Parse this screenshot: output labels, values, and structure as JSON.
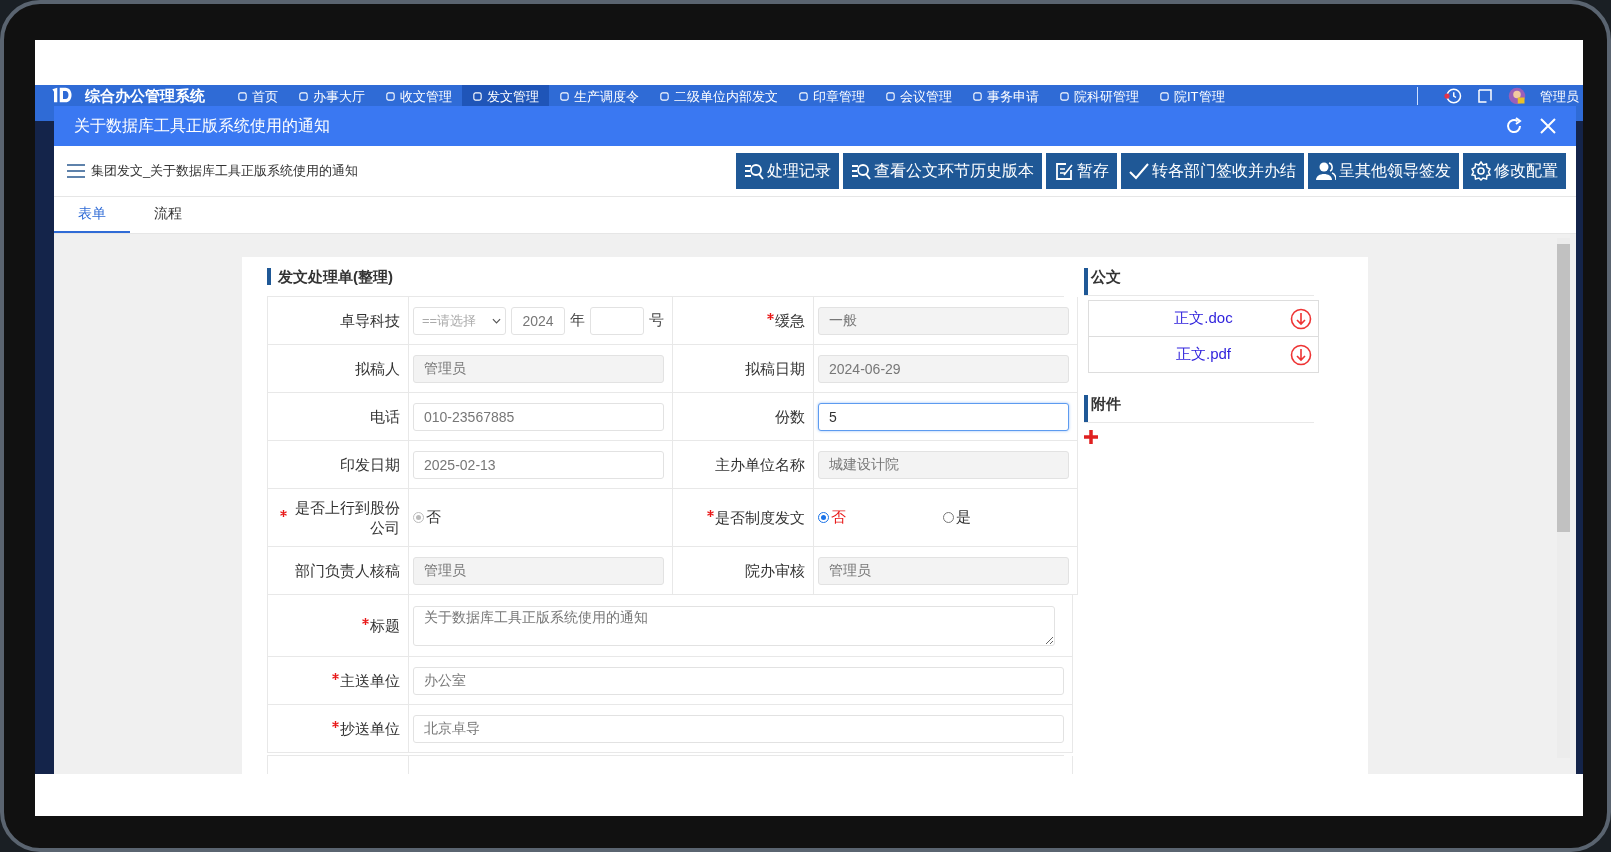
{
  "navbar": {
    "title": "综合办公管理系统",
    "items": [
      {
        "label": "首页",
        "selected": false
      },
      {
        "label": "办事大厅",
        "selected": false
      },
      {
        "label": "收文管理",
        "selected": false
      },
      {
        "label": "发文管理",
        "selected": true
      },
      {
        "label": "生产调度令",
        "selected": false
      },
      {
        "label": "二级单位内部发文",
        "selected": false
      },
      {
        "label": "印章管理",
        "selected": false
      },
      {
        "label": "会议管理",
        "selected": false
      },
      {
        "label": "事务申请",
        "selected": false
      },
      {
        "label": "院科研管理",
        "selected": false
      },
      {
        "label": "院IT管理",
        "selected": false
      }
    ],
    "user": "管理员"
  },
  "dialog": {
    "title": "关于数据库工具正版系统使用的通知",
    "breadcrumb": "集团发文_关于数据库工具正版系统使用的通知",
    "buttons": [
      {
        "label": "处理记录",
        "kind": "history"
      },
      {
        "label": "查看公文环节历史版本",
        "kind": "history"
      },
      {
        "label": "暂存",
        "kind": "save"
      },
      {
        "label": "转各部门签收并办结",
        "kind": "finish"
      },
      {
        "label": "呈其他领导签发",
        "kind": "forward"
      },
      {
        "label": "修改配置",
        "kind": "settings"
      }
    ],
    "tabs": [
      {
        "label": "表单",
        "selected": true
      },
      {
        "label": "流程",
        "selected": false
      }
    ],
    "form": {
      "title": "发文处理单(整理)",
      "rows": [
        [
          {
            "label": "卓导科技",
            "required": false,
            "kind": "doc-number",
            "select": "==请选择",
            "year": "2024",
            "year_unit": "年",
            "number_unit": "号"
          },
          {
            "label": "缓急",
            "required": true,
            "kind": "input",
            "value": "一般",
            "readonly": true
          }
        ],
        [
          {
            "label": "拟稿人",
            "required": false,
            "kind": "input",
            "value": "管理员",
            "readonly": true
          },
          {
            "label": "拟稿日期",
            "required": false,
            "kind": "input",
            "value": "2024-06-29",
            "readonly": true
          }
        ],
        [
          {
            "label": "电话",
            "required": false,
            "kind": "input",
            "value": "010-23567885",
            "readonly": false
          },
          {
            "label": "份数",
            "required": false,
            "kind": "input",
            "value": "5",
            "readonly": false,
            "focused": true
          }
        ],
        [
          {
            "label": "印发日期",
            "required": false,
            "kind": "input",
            "value": "2025-02-13",
            "readonly": false
          },
          {
            "label": "主办单位名称",
            "required": false,
            "kind": "input",
            "value": "城建设计院",
            "readonly": true
          }
        ],
        [
          {
            "label": "是否上行到股份公司",
            "required": true,
            "kind": "radio",
            "options": [
              {
                "label": "否",
                "selected": true,
                "disabled": true
              }
            ]
          },
          {
            "label": "是否制度发文",
            "required": true,
            "kind": "radio",
            "options": [
              {
                "label": "否",
                "selected": true,
                "disabled": false
              },
              {
                "label": "是",
                "selected": false,
                "disabled": false
              }
            ]
          }
        ],
        [
          {
            "label": "部门负责人核稿",
            "required": false,
            "kind": "input",
            "value": "管理员",
            "readonly": true
          },
          {
            "label": "院办审核",
            "required": false,
            "kind": "input",
            "value": "管理员",
            "readonly": true
          }
        ],
        [
          {
            "label": "标题",
            "required": true,
            "kind": "textarea",
            "value": "关于数据库工具正版系统使用的通知",
            "readonly": false
          }
        ],
        [
          {
            "label": "主送单位",
            "required": true,
            "kind": "input",
            "value": "办公室",
            "readonly": false
          }
        ],
        [
          {
            "label": "抄送单位",
            "required": true,
            "kind": "input",
            "value": "北京卓导",
            "readonly": false
          }
        ]
      ]
    },
    "documents": {
      "title": "公文",
      "files": [
        "正文.doc",
        "正文.pdf"
      ]
    },
    "attachments": {
      "title": "附件"
    }
  }
}
